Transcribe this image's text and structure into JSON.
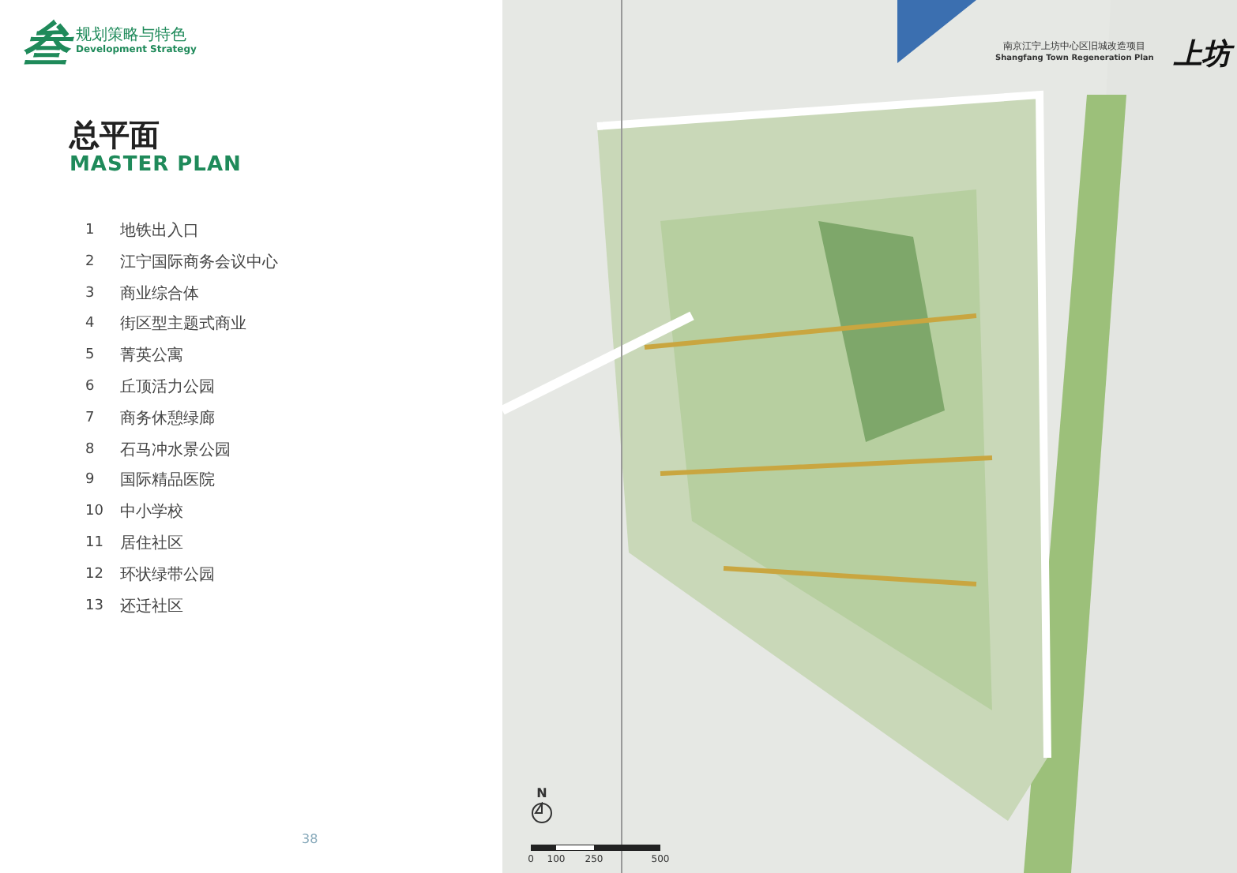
{
  "header": {
    "chapter_mark": "叁",
    "chapter_title": "规划策略与特色",
    "chapter_subtitle": "Development Strategy"
  },
  "title": "总平面",
  "subtitle": "MASTER PLAN",
  "legend": [
    {
      "number": "1",
      "label": "地铁出入口"
    },
    {
      "number": "2",
      "label": "江宁国际商务会议中心"
    },
    {
      "number": "3",
      "label": "商业综合体"
    },
    {
      "number": "4",
      "label": "街区型主题式商业"
    },
    {
      "number": "5",
      "label": "菁英公寓"
    },
    {
      "number": "6",
      "label": "丘顶活力公园"
    },
    {
      "number": "7",
      "label": "商务休憩绿廊"
    },
    {
      "number": "8",
      "label": "石马冲水景公园"
    },
    {
      "number": "9",
      "label": "国际精品医院"
    },
    {
      "number": "10",
      "label": "中小学校"
    },
    {
      "number": "11",
      "label": "居住社区"
    },
    {
      "number": "12",
      "label": "环状绿带公园"
    },
    {
      "number": "13",
      "label": "还迁社区"
    }
  ],
  "page_number": "38",
  "map": {
    "project_title": "南京江宁上坊中心区旧城改造项目",
    "project_subtitle": "Shangfang Town Regeneration Plan",
    "logo": "上坊",
    "north_label": "N",
    "scale_labels": [
      "0",
      "100",
      "250",
      "500"
    ]
  }
}
